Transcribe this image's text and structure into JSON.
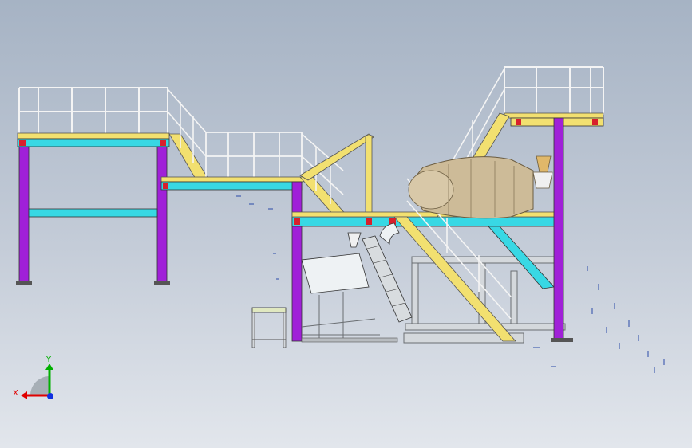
{
  "model": {
    "name": "",
    "view": "front",
    "colors": {
      "background_top": "#a6b3c4",
      "background_bottom": "#e2e6ec",
      "column": "#a020d8",
      "beam": "#38d8e4",
      "stair": "#f2e070",
      "rail": "#ffffff",
      "flange_red": "#d8202c",
      "tank": "#c8b896",
      "steel_gray": "#c8ccd0"
    }
  },
  "triad": {
    "x_label": "X",
    "y_label": "Y",
    "x_color": "#e00000",
    "y_color": "#00b000",
    "z_color": "#1030e0"
  }
}
